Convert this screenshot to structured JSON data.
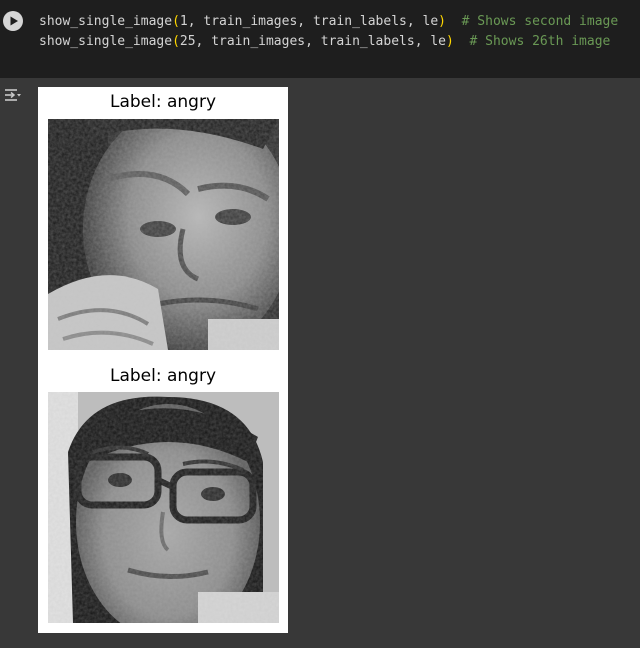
{
  "code": {
    "line1": {
      "call": "show_single_image",
      "open": "(",
      "args": "1, train_images, train_labels, le",
      "close": ")",
      "gap": "  ",
      "comment": "# Shows second image"
    },
    "line2": {
      "call": "show_single_image",
      "open": "(",
      "args": "25, train_images, train_labels, le",
      "close": ")",
      "gap": "  ",
      "comment": "# Shows 26th image"
    }
  },
  "icons": {
    "run": "play-icon",
    "output": "output-toggle-icon"
  },
  "figure": {
    "subplots": [
      {
        "title": "Label: angry",
        "image": "grayscale face photo (man, hand on chin)"
      },
      {
        "title": "Label: angry",
        "image": "grayscale face photo (woman with glasses)"
      }
    ]
  },
  "colors": {
    "editor_bg": "#1e1e1e",
    "output_bg": "#383838",
    "code_text": "#d4d4d4",
    "paren": "#ffd700",
    "comment": "#6a9955"
  }
}
